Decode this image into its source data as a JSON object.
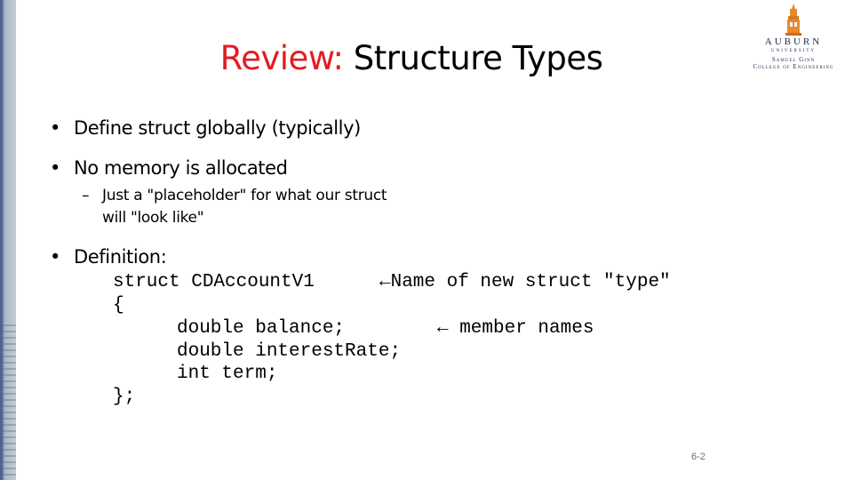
{
  "slide": {
    "title_accent": "Review:",
    "title_main": " Structure Types",
    "accent_color": "#e31b23",
    "logo": {
      "name": "AUBURN",
      "university": "UNIVERSITY",
      "college_line1": "Samuel Ginn",
      "college_line2": "College of Engineering"
    },
    "bullets": [
      {
        "text": "Define struct globally (typically)"
      },
      {
        "text": "No memory is allocated",
        "sub": {
          "line1": "Just a \"placeholder\" for what our struct",
          "line2": "will \"look like\""
        }
      },
      {
        "text": "Definition:"
      }
    ],
    "bullet_glyph": "•",
    "dash_glyph": "–",
    "code": {
      "line1": "struct CDAccountV1",
      "line2": "{",
      "line3": "double balance;",
      "line4": "double interestRate;",
      "line5": "int term;",
      "line6": "};"
    },
    "annotations": {
      "name_note": "←Name of new struct \"type\"",
      "member_note": "← member names"
    },
    "page_number": "6-2"
  }
}
